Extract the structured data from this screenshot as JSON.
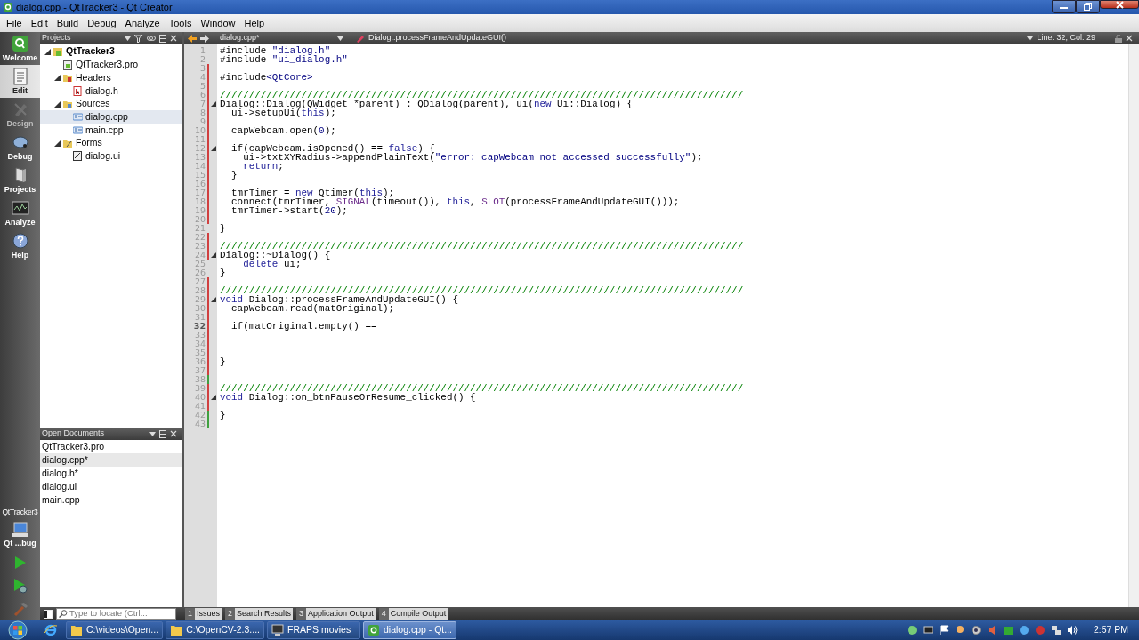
{
  "window": {
    "title": "dialog.cpp - QtTracker3 - Qt Creator"
  },
  "menu": [
    "File",
    "Edit",
    "Build",
    "Debug",
    "Analyze",
    "Tools",
    "Window",
    "Help"
  ],
  "modes": [
    {
      "kind": "welcome",
      "label": "Welcome",
      "selected": false,
      "disabled": false
    },
    {
      "kind": "edit",
      "label": "Edit",
      "selected": true,
      "disabled": false
    },
    {
      "kind": "design",
      "label": "Design",
      "selected": false,
      "disabled": true
    },
    {
      "kind": "debug",
      "label": "Debug",
      "selected": false,
      "disabled": false
    },
    {
      "kind": "projects",
      "label": "Projects",
      "selected": false,
      "disabled": false
    },
    {
      "kind": "analyze",
      "label": "Analyze",
      "selected": false,
      "disabled": false
    },
    {
      "kind": "help",
      "label": "Help",
      "selected": false,
      "disabled": false
    }
  ],
  "target": {
    "project": "QtTracker3",
    "kit": "Qt ...bug"
  },
  "projects_panel": {
    "title": "Projects",
    "tree": [
      {
        "kind": "project",
        "label": "QtTracker3",
        "expanded": true,
        "selected": false,
        "children": [
          {
            "kind": "profile",
            "label": "QtTracker3.pro",
            "selected": false
          },
          {
            "kind": "headers",
            "label": "Headers",
            "expanded": true,
            "selected": false,
            "children": [
              {
                "kind": "header",
                "label": "dialog.h",
                "selected": false
              }
            ]
          },
          {
            "kind": "sources",
            "label": "Sources",
            "expanded": true,
            "selected": false,
            "children": [
              {
                "kind": "source",
                "label": "dialog.cpp",
                "selected": true
              },
              {
                "kind": "source",
                "label": "main.cpp",
                "selected": false
              }
            ]
          },
          {
            "kind": "forms",
            "label": "Forms",
            "expanded": true,
            "selected": false,
            "children": [
              {
                "kind": "form",
                "label": "dialog.ui",
                "selected": false
              }
            ]
          }
        ]
      }
    ]
  },
  "open_documents": {
    "title": "Open Documents",
    "items": [
      {
        "label": "QtTracker3.pro",
        "selected": false
      },
      {
        "label": "dialog.cpp*",
        "selected": true
      },
      {
        "label": "dialog.h*",
        "selected": false
      },
      {
        "label": "dialog.ui",
        "selected": false
      },
      {
        "label": "main.cpp",
        "selected": false
      }
    ]
  },
  "editor": {
    "file": "dialog.cpp*",
    "symbol": "Dialog::processFrameAndUpdateGUI()",
    "position": "Line: 32, Col: 29",
    "lines": [
      {
        "n": "1",
        "unsaved": false,
        "saved": false,
        "fold": false,
        "current": false,
        "code": [
          {
            "kind": "plain",
            "text": "#include "
          },
          {
            "kind": "string",
            "text": "\"dialog.h\""
          }
        ]
      },
      {
        "n": "2",
        "unsaved": false,
        "saved": false,
        "fold": false,
        "current": false,
        "code": [
          {
            "kind": "plain",
            "text": "#include "
          },
          {
            "kind": "string",
            "text": "\"ui_dialog.h\""
          }
        ]
      },
      {
        "n": "3",
        "unsaved": true,
        "saved": false,
        "fold": false,
        "current": false
      },
      {
        "n": "4",
        "unsaved": true,
        "saved": false,
        "fold": false,
        "current": false,
        "code": [
          {
            "kind": "plain",
            "text": "#include"
          },
          {
            "kind": "string",
            "text": "<QtCore>"
          }
        ]
      },
      {
        "n": "5",
        "unsaved": true,
        "saved": false,
        "fold": false,
        "current": false
      },
      {
        "n": "6",
        "unsaved": true,
        "saved": false,
        "fold": false,
        "current": false,
        "code": [
          {
            "kind": "comment",
            "text": "//////////////////////////////////////////////////////////////////////////////////////////"
          }
        ]
      },
      {
        "n": "7",
        "unsaved": true,
        "saved": false,
        "fold": true,
        "current": false,
        "code": [
          {
            "kind": "plain",
            "text": "Dialog::Dialog(QWidget *parent) : QDialog(parent), ui("
          },
          {
            "kind": "keyword",
            "text": "new"
          },
          {
            "kind": "plain",
            "text": " Ui::Dialog) {"
          }
        ]
      },
      {
        "n": "8",
        "unsaved": true,
        "saved": false,
        "fold": false,
        "current": false,
        "code": [
          {
            "kind": "plain",
            "text": "  ui->setupUi("
          },
          {
            "kind": "keyword",
            "text": "this"
          },
          {
            "kind": "plain",
            "text": ");"
          }
        ]
      },
      {
        "n": "9",
        "unsaved": true,
        "saved": false,
        "fold": false,
        "current": false
      },
      {
        "n": "10",
        "unsaved": true,
        "saved": false,
        "fold": false,
        "current": false,
        "code": [
          {
            "kind": "plain",
            "text": "  capWebcam.open("
          },
          {
            "kind": "number",
            "text": "0"
          },
          {
            "kind": "plain",
            "text": ");"
          }
        ]
      },
      {
        "n": "11",
        "unsaved": true,
        "saved": false,
        "fold": false,
        "current": false
      },
      {
        "n": "12",
        "unsaved": true,
        "saved": false,
        "fold": true,
        "current": false,
        "code": [
          {
            "kind": "plain",
            "text": "  if(capWebcam.isOpened() == "
          },
          {
            "kind": "keyword",
            "text": "false"
          },
          {
            "kind": "plain",
            "text": ") {"
          }
        ]
      },
      {
        "n": "13",
        "unsaved": true,
        "saved": false,
        "fold": false,
        "current": false,
        "code": [
          {
            "kind": "plain",
            "text": "    ui->txtXYRadius->appendPlainText("
          },
          {
            "kind": "string",
            "text": "\"error: capWebcam not accessed successfully\""
          },
          {
            "kind": "plain",
            "text": ");"
          }
        ]
      },
      {
        "n": "14",
        "unsaved": true,
        "saved": false,
        "fold": false,
        "current": false,
        "code": [
          {
            "kind": "keyword",
            "text": "    return"
          },
          {
            "kind": "plain",
            "text": ";"
          }
        ]
      },
      {
        "n": "15",
        "unsaved": true,
        "saved": false,
        "fold": false,
        "current": false,
        "code": [
          {
            "kind": "plain",
            "text": "  }"
          }
        ]
      },
      {
        "n": "16",
        "unsaved": true,
        "saved": false,
        "fold": false,
        "current": false
      },
      {
        "n": "17",
        "unsaved": true,
        "saved": false,
        "fold": false,
        "current": false,
        "code": [
          {
            "kind": "plain",
            "text": "  tmrTimer = "
          },
          {
            "kind": "keyword",
            "text": "new"
          },
          {
            "kind": "plain",
            "text": " Qtimer("
          },
          {
            "kind": "keyword",
            "text": "this"
          },
          {
            "kind": "plain",
            "text": ");"
          }
        ]
      },
      {
        "n": "18",
        "unsaved": true,
        "saved": false,
        "fold": false,
        "current": false,
        "code": [
          {
            "kind": "plain",
            "text": "  connect(tmrTimer, "
          },
          {
            "kind": "macro",
            "text": "SIGNAL"
          },
          {
            "kind": "plain",
            "text": "(timeout()), "
          },
          {
            "kind": "keyword",
            "text": "this"
          },
          {
            "kind": "plain",
            "text": ", "
          },
          {
            "kind": "macro",
            "text": "SLOT"
          },
          {
            "kind": "plain",
            "text": "(processFrameAndUpdateGUI()));"
          }
        ]
      },
      {
        "n": "19",
        "unsaved": true,
        "saved": false,
        "fold": false,
        "current": false,
        "code": [
          {
            "kind": "plain",
            "text": "  tmrTimer->start("
          },
          {
            "kind": "number",
            "text": "20"
          },
          {
            "kind": "plain",
            "text": ");"
          }
        ]
      },
      {
        "n": "20",
        "unsaved": true,
        "saved": false,
        "fold": false,
        "current": false
      },
      {
        "n": "21",
        "unsaved": false,
        "saved": false,
        "fold": false,
        "current": false,
        "code": [
          {
            "kind": "plain",
            "text": "}"
          }
        ]
      },
      {
        "n": "22",
        "unsaved": true,
        "saved": false,
        "fold": false,
        "current": false
      },
      {
        "n": "23",
        "unsaved": true,
        "saved": false,
        "fold": false,
        "current": false,
        "code": [
          {
            "kind": "comment",
            "text": "//////////////////////////////////////////////////////////////////////////////////////////"
          }
        ]
      },
      {
        "n": "24",
        "unsaved": true,
        "saved": false,
        "fold": true,
        "current": false,
        "code": [
          {
            "kind": "plain",
            "text": "Dialog::~Dialog() {"
          }
        ]
      },
      {
        "n": "25",
        "unsaved": false,
        "saved": false,
        "fold": false,
        "current": false,
        "code": [
          {
            "kind": "keyword",
            "text": "    delete"
          },
          {
            "kind": "plain",
            "text": " ui;"
          }
        ]
      },
      {
        "n": "26",
        "unsaved": false,
        "saved": false,
        "fold": false,
        "current": false,
        "code": [
          {
            "kind": "plain",
            "text": "}"
          }
        ]
      },
      {
        "n": "27",
        "unsaved": true,
        "saved": false,
        "fold": false,
        "current": false
      },
      {
        "n": "28",
        "unsaved": true,
        "saved": false,
        "fold": false,
        "current": false,
        "code": [
          {
            "kind": "comment",
            "text": "//////////////////////////////////////////////////////////////////////////////////////////"
          }
        ]
      },
      {
        "n": "29",
        "unsaved": true,
        "saved": false,
        "fold": true,
        "current": false,
        "code": [
          {
            "kind": "keyword",
            "text": "void"
          },
          {
            "kind": "plain",
            "text": " Dialog::processFrameAndUpdateGUI() {"
          }
        ]
      },
      {
        "n": "30",
        "unsaved": true,
        "saved": false,
        "fold": false,
        "current": false,
        "code": [
          {
            "kind": "plain",
            "text": "  capWebcam.read(matOriginal);"
          }
        ]
      },
      {
        "n": "31",
        "unsaved": true,
        "saved": false,
        "fold": false,
        "current": false
      },
      {
        "n": "32",
        "unsaved": true,
        "saved": false,
        "fold": false,
        "current": true,
        "code": [
          {
            "kind": "plain",
            "text": "  if(matOriginal.empty() == "
          }
        ]
      },
      {
        "n": "33",
        "unsaved": true,
        "saved": false,
        "fold": false,
        "current": false
      },
      {
        "n": "34",
        "unsaved": true,
        "saved": false,
        "fold": false,
        "current": false
      },
      {
        "n": "35",
        "unsaved": true,
        "saved": false,
        "fold": false,
        "current": false
      },
      {
        "n": "36",
        "unsaved": true,
        "saved": false,
        "fold": false,
        "current": false,
        "code": [
          {
            "kind": "plain",
            "text": "}"
          }
        ]
      },
      {
        "n": "37",
        "unsaved": true,
        "saved": false,
        "fold": false,
        "current": false
      },
      {
        "n": "38",
        "unsaved": false,
        "saved": true,
        "fold": false,
        "current": false
      },
      {
        "n": "39",
        "unsaved": true,
        "saved": false,
        "fold": false,
        "current": false,
        "code": [
          {
            "kind": "comment",
            "text": "//////////////////////////////////////////////////////////////////////////////////////////"
          }
        ]
      },
      {
        "n": "40",
        "unsaved": true,
        "saved": false,
        "fold": true,
        "current": false,
        "code": [
          {
            "kind": "keyword",
            "text": "void"
          },
          {
            "kind": "plain",
            "text": " Dialog::on_btnPauseOrResume_clicked() {"
          }
        ]
      },
      {
        "n": "41",
        "unsaved": true,
        "saved": false,
        "fold": false,
        "current": false
      },
      {
        "n": "42",
        "unsaved": false,
        "saved": true,
        "fold": false,
        "current": false,
        "code": [
          {
            "kind": "plain",
            "text": "}"
          }
        ]
      },
      {
        "n": "43",
        "unsaved": false,
        "saved": true,
        "fold": false,
        "current": false
      }
    ]
  },
  "locator": {
    "placeholder": "Type to locate (Ctrl..."
  },
  "output_tabs": [
    {
      "number": "1",
      "label": "Issues"
    },
    {
      "number": "2",
      "label": "Search Results"
    },
    {
      "number": "3",
      "label": "Application Output"
    },
    {
      "number": "4",
      "label": "Compile Output"
    }
  ],
  "taskbar": {
    "tasks": [
      {
        "kind": "folder",
        "label": "C:\\videos\\Open...",
        "selected": false
      },
      {
        "kind": "folder",
        "label": "C:\\OpenCV-2.3....",
        "selected": false
      },
      {
        "kind": "movie",
        "label": "FRAPS movies",
        "selected": false
      },
      {
        "kind": "qt",
        "label": "dialog.cpp - Qt...",
        "selected": true
      }
    ],
    "clock": "2:57 PM"
  }
}
